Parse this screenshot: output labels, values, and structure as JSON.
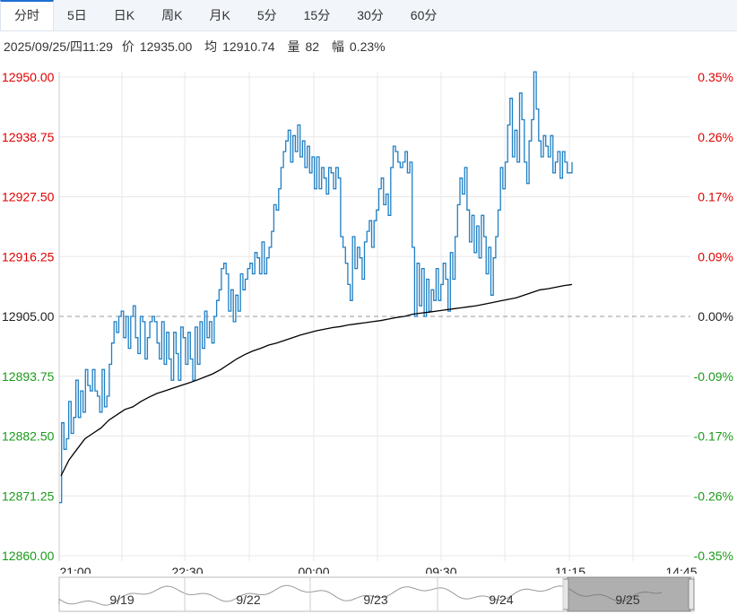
{
  "tabs": [
    {
      "label": "分时",
      "active": true
    },
    {
      "label": "5日"
    },
    {
      "label": "日K"
    },
    {
      "label": "周K"
    },
    {
      "label": "月K"
    },
    {
      "label": "5分"
    },
    {
      "label": "15分"
    },
    {
      "label": "30分"
    },
    {
      "label": "60分"
    }
  ],
  "info": {
    "datetime": "2025/09/25/四11:29",
    "price_label": "价",
    "price": "12935.00",
    "avg_label": "均",
    "avg": "12910.74",
    "vol_label": "量",
    "vol": "82",
    "range_label": "幅",
    "range": "0.23%"
  },
  "colors": {
    "price_line": "#1f7fc4",
    "avg_line": "#000000",
    "up": "#e00000",
    "down": "#1a9a1a",
    "neutral": "#222222",
    "grid": "#e8e8e8",
    "baseline": "#999999"
  },
  "navigator": {
    "dates": [
      "9/19",
      "9/22",
      "9/23",
      "9/24",
      "9/25"
    ]
  },
  "chart_data": {
    "type": "line",
    "ylim": [
      12860.0,
      12950.0
    ],
    "base": 12905.0,
    "y_ticks": [
      "12950.00",
      "12938.75",
      "12927.50",
      "12916.25",
      "12905.00",
      "12893.75",
      "12882.50",
      "12871.25",
      "12860.00"
    ],
    "pct_ticks": [
      "0.35%",
      "0.26%",
      "0.17%",
      "0.09%",
      "0.00%",
      "-0.09%",
      "-0.17%",
      "-0.26%",
      "-0.35%"
    ],
    "x_ticks": [
      "21:00",
      "22:30",
      "00:00",
      "09:30",
      "11:15",
      "14:45"
    ],
    "x_range_minutes": 720,
    "grid": true,
    "series": [
      {
        "role": "price",
        "values": [
          12870,
          12885,
          12880,
          12882,
          12889,
          12883,
          12886,
          12893,
          12886,
          12891,
          12887,
          12895,
          12892,
          12891,
          12895,
          12891,
          12890,
          12887,
          12895,
          12888,
          12890,
          12896,
          12900,
          12904,
          12902,
          12905,
          12906,
          12901,
          12905,
          12899,
          12905,
          12907,
          12901,
          12898,
          12905,
          12904,
          12897,
          12901,
          12904,
          12905,
          12904,
          12900,
          12897,
          12904,
          12896,
          12902,
          12897,
          12893,
          12902,
          12898,
          12893,
          12903,
          12901,
          12896,
          12902,
          12897,
          12893,
          12903,
          12896,
          12904,
          12899,
          12906,
          12901,
          12904,
          12900,
          12905,
          12908,
          12910,
          12914,
          12915,
          12913,
          12906,
          12910,
          12904,
          12909,
          12906,
          12913,
          12910,
          12912,
          12914,
          12915,
          12913,
          12917,
          12916,
          12913,
          12919,
          12913,
          12916,
          12918,
          12921,
          12926,
          12925,
          12929,
          12933,
          12936,
          12938,
          12940,
          12934,
          12939,
          12936,
          12941,
          12935,
          12938,
          12933,
          12937,
          12932,
          12935,
          12929,
          12935,
          12929,
          12933,
          12931,
          12928,
          12933,
          12932,
          12929,
          12933,
          12931,
          12920,
          12918,
          12915,
          12911,
          12908,
          12920,
          12914,
          12918,
          12916,
          12912,
          12919,
          12921,
          12923,
          12918,
          12923,
          12925,
          12929,
          12931,
          12926,
          12928,
          12924,
          12933,
          12937,
          12936,
          12934,
          12933,
          12934,
          12936,
          12932,
          12934,
          12918,
          12905,
          12915,
          12907,
          12914,
          12905,
          12912,
          12906,
          12910,
          12908,
          12914,
          12908,
          12911,
          12915,
          12912,
          12906,
          12917,
          12912,
          12920,
          12926,
          12931,
          12928,
          12933,
          12925,
          12919,
          12924,
          12917,
          12922,
          12916,
          12924,
          12920,
          12913,
          12918,
          12909,
          12916,
          12920,
          12925,
          12933,
          12929,
          12934,
          12941,
          12946,
          12935,
          12940,
          12934,
          12947,
          12942,
          12934,
          12930,
          12938,
          12942,
          12951,
          12944,
          12938,
          12935,
          12939,
          12937,
          12935,
          12939,
          12932,
          12934,
          12936,
          12931,
          12936,
          12934,
          12932,
          12932,
          12934
        ]
      },
      {
        "role": "average",
        "values": [
          12875,
          12878,
          12880,
          12882,
          12883,
          12884,
          12885.5,
          12886.5,
          12887.5,
          12888,
          12889,
          12889.8,
          12890.5,
          12891,
          12891.5,
          12892,
          12892.5,
          12893,
          12893.6,
          12894.2,
          12895,
          12896,
          12897,
          12897.8,
          12898.5,
          12899,
          12899.6,
          12900,
          12900.5,
          12901,
          12901.5,
          12901.9,
          12902.3,
          12902.6,
          12902.9,
          12903.1,
          12903.4,
          12903.6,
          12903.8,
          12904,
          12904.2,
          12904.5,
          12904.8,
          12905,
          12905.4,
          12905.6,
          12905.8,
          12906,
          12906.2,
          12906.4,
          12906.6,
          12906.8,
          12907,
          12907.3,
          12907.6,
          12907.9,
          12908.2,
          12908.5,
          12909,
          12909.5,
          12910,
          12910.2,
          12910.5,
          12910.8,
          12911
        ]
      }
    ]
  }
}
